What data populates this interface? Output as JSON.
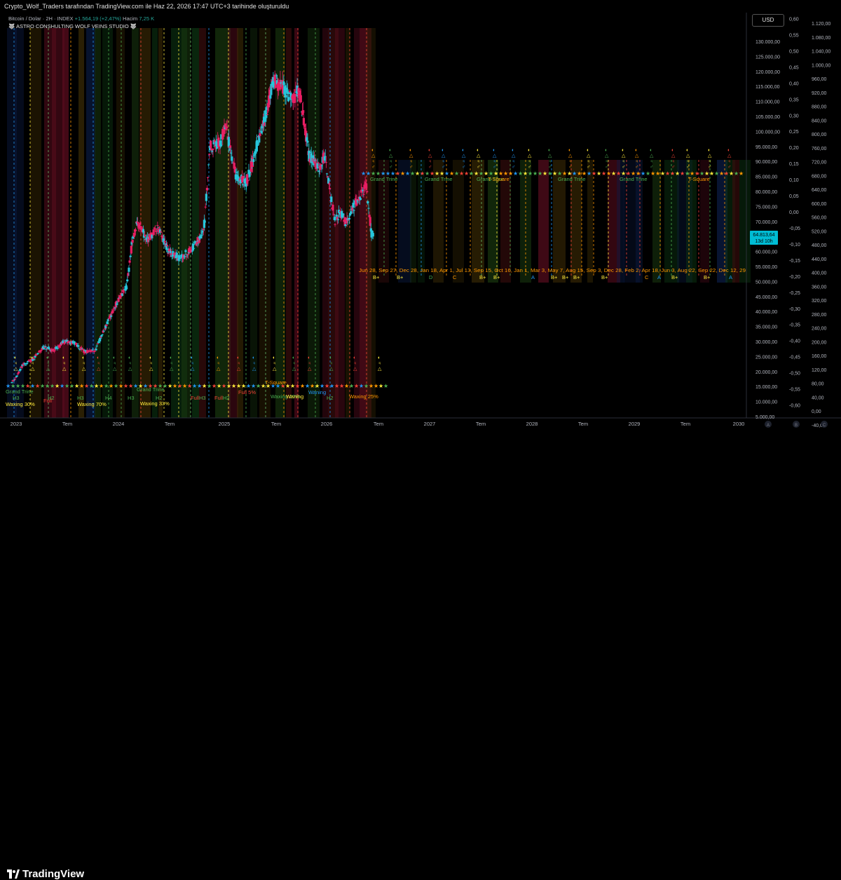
{
  "header": {
    "attribution": "Crypto_Wolf_Traders tarafından TradingView.com ile Haz 22, 2026 17:47 UTC+3 tarihinde oluşturuldu",
    "symbol_line": "Bitcoin / Dolar · 2H · INDEX",
    "change": "+1.564,19 (+2,47%)",
    "volume_label": "Hacim",
    "volume_value": "7,25 K",
    "indicator": "🐺 ASTRO CONSHULTING WOLF VEINS STUDIO 🐺",
    "currency_button": "USD"
  },
  "price_badge": {
    "price": "64.813,64",
    "countdown": "13d 10h"
  },
  "footer": {
    "brand": "TradingView"
  },
  "colors": {
    "up": "#26c6da",
    "down": "#e91e63",
    "background": "#000000"
  },
  "chart_data": {
    "type": "candlestick",
    "x_axis": [
      "2023",
      "Tem",
      "2024",
      "Tem",
      "2025",
      "Tem",
      "2026",
      "Tem",
      "2027",
      "Tem",
      "2028",
      "Tem",
      "2029",
      "Tem",
      "2030"
    ],
    "y_axis_price": [
      "130.000,00",
      "125.000,00",
      "120.000,00",
      "115.000,00",
      "110.000,00",
      "105.000,00",
      "100.000,00",
      "95.000,00",
      "90.000,00",
      "85.000,00",
      "80.000,00",
      "75.000,00",
      "70.000,00",
      "65.000,00",
      "60.000,00",
      "55.000,00",
      "50.000,00",
      "45.000,00",
      "40.000,00",
      "35.000,00",
      "30.000,00",
      "25.000,00",
      "20.000,00",
      "15.000,00",
      "10.000,00",
      "5.000,00"
    ],
    "y_axis_indicator": [
      "0,60",
      "0,55",
      "0,50",
      "0,45",
      "0,40",
      "0,35",
      "0,30",
      "0,25",
      "0,20",
      "0,15",
      "0,10",
      "0,05",
      "0,00",
      "-0,05",
      "-0,10",
      "-0,15",
      "-0,20",
      "-0,25",
      "-0,30",
      "-0,35",
      "-0,40",
      "-0,45",
      "-0,50",
      "-0,55",
      "-0,60"
    ],
    "y_axis_right": [
      "1.120,00",
      "1.080,00",
      "1.040,00",
      "1.000,00",
      "960,00",
      "920,00",
      "880,00",
      "840,00",
      "800,00",
      "760,00",
      "720,00",
      "680,00",
      "640,00",
      "600,00",
      "560,00",
      "520,00",
      "480,00",
      "440,00",
      "400,00",
      "360,00",
      "320,00",
      "280,00",
      "240,00",
      "200,00",
      "160,00",
      "120,00",
      "80,00",
      "40,00",
      "0,00",
      "-40,00"
    ],
    "price_range": [
      5000,
      135000
    ],
    "price_series_approx": [
      [
        2023.0,
        16500
      ],
      [
        2023.05,
        18500
      ],
      [
        2023.1,
        22000
      ],
      [
        2023.2,
        24000
      ],
      [
        2023.3,
        28000
      ],
      [
        2023.4,
        27000
      ],
      [
        2023.5,
        30000
      ],
      [
        2023.6,
        29500
      ],
      [
        2023.7,
        26500
      ],
      [
        2023.8,
        27000
      ],
      [
        2023.9,
        35000
      ],
      [
        2024.0,
        42500
      ],
      [
        2024.1,
        48000
      ],
      [
        2024.15,
        62000
      ],
      [
        2024.2,
        70000
      ],
      [
        2024.3,
        64000
      ],
      [
        2024.4,
        68000
      ],
      [
        2024.5,
        60000
      ],
      [
        2024.6,
        58000
      ],
      [
        2024.7,
        60000
      ],
      [
        2024.8,
        64000
      ],
      [
        2024.85,
        70000
      ],
      [
        2024.9,
        95000
      ],
      [
        2025.0,
        96000
      ],
      [
        2025.05,
        102000
      ],
      [
        2025.15,
        85000
      ],
      [
        2025.25,
        83000
      ],
      [
        2025.35,
        95000
      ],
      [
        2025.45,
        107000
      ],
      [
        2025.5,
        117000
      ],
      [
        2025.6,
        115000
      ],
      [
        2025.7,
        110000
      ],
      [
        2025.75,
        115000
      ],
      [
        2025.8,
        104000
      ],
      [
        2025.85,
        92000
      ],
      [
        2025.95,
        88000
      ],
      [
        2026.0,
        92000
      ],
      [
        2026.05,
        80000
      ],
      [
        2026.1,
        70000
      ],
      [
        2026.15,
        73000
      ],
      [
        2026.2,
        70000
      ],
      [
        2026.3,
        76000
      ],
      [
        2026.4,
        82000
      ],
      [
        2026.45,
        66000
      ],
      [
        2026.47,
        64813
      ]
    ],
    "annotations_top": [
      "Grand Trine",
      "Grand Trine",
      "Grand Trine",
      "T-Square",
      "Grand Trine",
      "Grand Trine",
      "T-Square"
    ],
    "date_labels": "Jun 28, Sep 27, Dec 28, Jan 18, Apr 1, Jul 13, Sep 15, Oct 16, Jan 1, Mar 3, May 7, Aug 15, Sep 3, Dec 28, Feb 2, Apr 18, Jun 3, Aug 22, Sep 22, Dec 12, 29",
    "date_codes": [
      "B+",
      "B+",
      "D",
      "C",
      "B+",
      "B+",
      "A",
      "B+",
      "B+",
      "B+",
      "B+",
      "C",
      "A",
      "B+",
      "B+",
      "A"
    ],
    "annotations_bottom": [
      "Grand Trine",
      "Waxing 30%",
      "Full",
      "Waxing 70%",
      "Grand Trine",
      "Waxing 33%",
      "Full",
      "Full",
      "Full 5%",
      "Waxing 20%",
      "Waning",
      "T-Square",
      "Waning",
      "Waxing 25%"
    ],
    "bottom_codes": [
      "H3",
      "H2",
      "H3",
      "H4",
      "H3",
      "H2",
      "H3",
      "H2",
      "H2"
    ]
  }
}
